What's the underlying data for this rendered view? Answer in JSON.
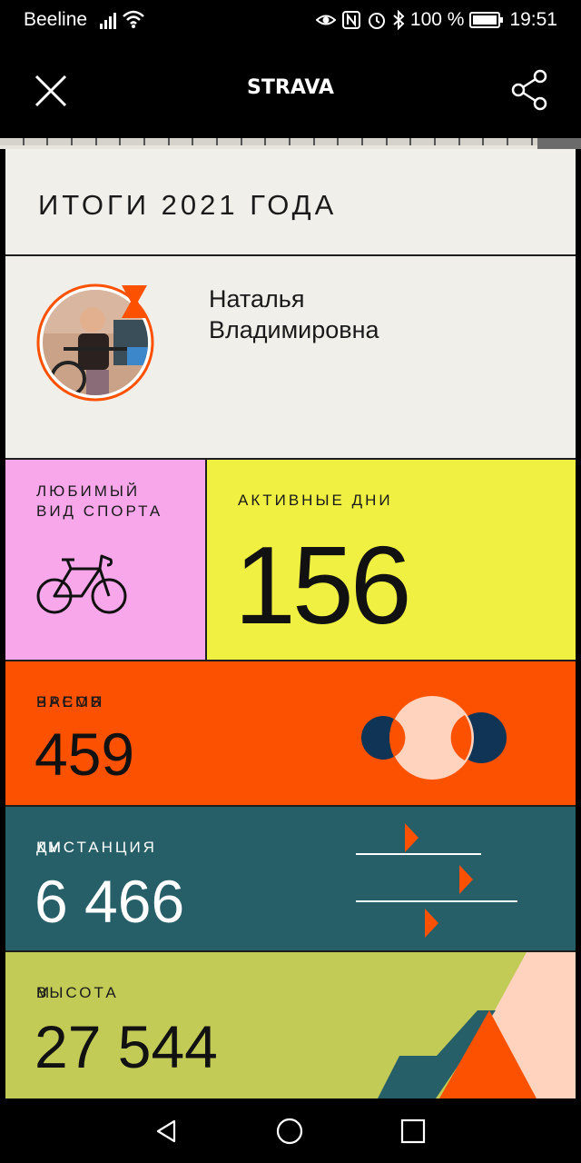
{
  "status_bar": {
    "carrier": "Beeline",
    "battery_text": "100 %",
    "time": "19:51",
    "icons": [
      "signal-icon",
      "wifi-icon",
      "eye-icon",
      "nfc-icon",
      "alarm-icon",
      "bluetooth-icon",
      "battery-icon"
    ]
  },
  "app_bar": {
    "brand": "STRAVA",
    "close_icon": "close-icon",
    "share_icon": "share-icon"
  },
  "story_progress": {
    "segments_total": 24,
    "segments_done": 24
  },
  "card": {
    "title": "ИТОГИ 2021 ГОДА",
    "profile": {
      "name_line1": "Наталья",
      "name_line2": "Владимировна"
    },
    "favorite_sport": {
      "label_line1": "ЛЮБИМЫЙ",
      "label_line2": "ВИД СПОРТА",
      "icon": "bike-icon"
    },
    "active_days": {
      "label": "АКТИВНЫЕ ДНИ",
      "value": "156"
    },
    "time": {
      "label": "ВРЕМЯ",
      "unit": "ЧАСОВ",
      "value": "459"
    },
    "distance": {
      "label": "ДИСТАНЦИЯ",
      "unit": "КМ",
      "value": "6 466"
    },
    "elevation": {
      "label": "ВЫСОТА",
      "unit": "М",
      "value": "27 544"
    }
  },
  "colors": {
    "strava_orange": "#fc5200",
    "pink": "#f7a7ea",
    "yellow": "#f0f043",
    "teal": "#275f68",
    "olive": "#c2cb56",
    "navy": "#0f3456",
    "peach": "#ffd3bd"
  },
  "nav_bar": {
    "icons": [
      "back-icon",
      "home-icon",
      "recents-icon"
    ]
  }
}
